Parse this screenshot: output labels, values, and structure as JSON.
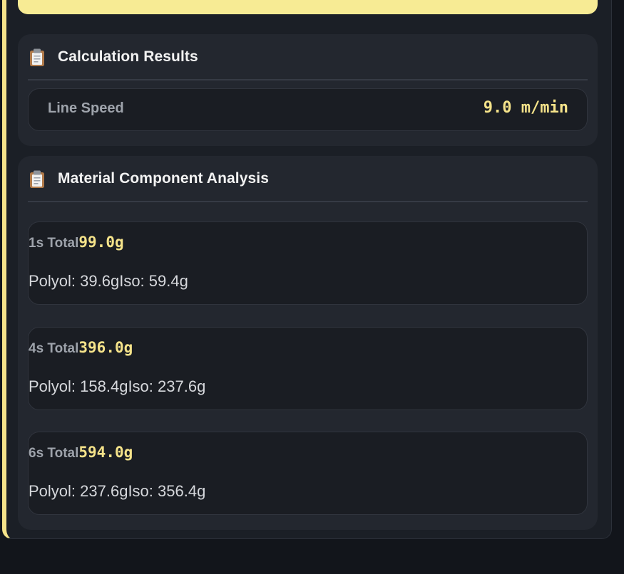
{
  "results": {
    "title": "Calculation Results",
    "icon": "clipboard-icon",
    "line_speed_label": "Line Speed",
    "line_speed_value": "9.0 m/min"
  },
  "analysis": {
    "title": "Material Component Analysis",
    "icon": "clipboard-icon",
    "items": [
      {
        "label": "1s Total",
        "total": "99.0g",
        "polyol": "Polyol: 39.6g",
        "iso": "Iso: 59.4g"
      },
      {
        "label": "4s Total",
        "total": "396.0g",
        "polyol": "Polyol: 158.4g",
        "iso": "Iso: 237.6g"
      },
      {
        "label": "6s Total",
        "total": "594.0g",
        "polyol": "Polyol: 237.6g",
        "iso": "Iso: 356.4g"
      }
    ]
  },
  "colors": {
    "accent": "#f5e38a",
    "background": "#12151b",
    "card": "#23272f",
    "row": "#1a1d23"
  }
}
